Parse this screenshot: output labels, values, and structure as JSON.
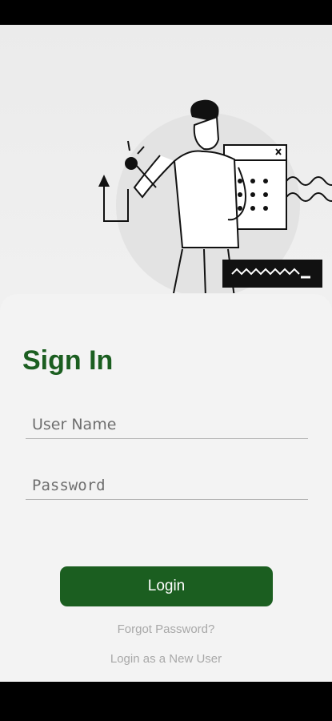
{
  "signin": {
    "title": "Sign In",
    "username_placeholder": "User Name",
    "password_placeholder": "Password",
    "login_label": "Login",
    "forgot_label": "Forgot Password?",
    "new_user_label": "Login as a New User"
  },
  "colors": {
    "brand_green": "#1b5e20",
    "background": "#f3f3f3",
    "link_gray": "#a8a8a8"
  },
  "icons": [
    "person-clicking-illustration",
    "up-arrow-icon",
    "window-close-icon",
    "wavy-line-icon",
    "keypad-dots-icon"
  ]
}
